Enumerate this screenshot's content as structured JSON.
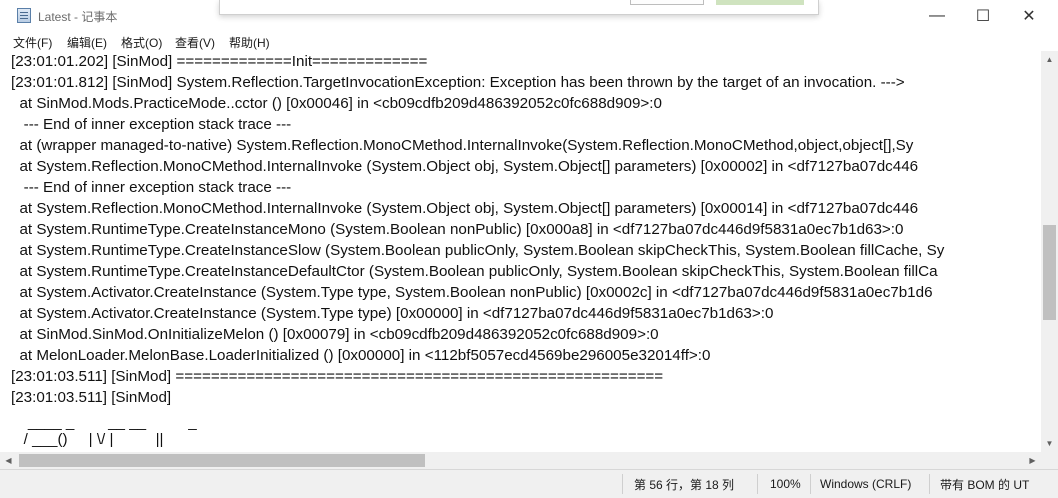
{
  "window": {
    "title": "Latest - 记事本",
    "controls": {
      "minimize": "—",
      "maximize": "☐",
      "close": "✕"
    }
  },
  "menu": [
    "文件(F)",
    "编辑(E)",
    "格式(O)",
    "查看(V)",
    "帮助(H)"
  ],
  "editor": {
    "lines": [
      "[23:01:01.202] [SinMod] =============Init=============",
      "[23:01:01.812] [SinMod] System.Reflection.TargetInvocationException: Exception has been thrown by the target of an invocation. --->",
      "  at SinMod.Mods.PracticeMode..cctor () [0x00046] in <cb09cdfb209d486392052c0fc688d909>:0",
      "   --- End of inner exception stack trace ---",
      "  at (wrapper managed-to-native) System.Reflection.MonoCMethod.InternalInvoke(System.Reflection.MonoCMethod,object,object[],Sy",
      "  at System.Reflection.MonoCMethod.InternalInvoke (System.Object obj, System.Object[] parameters) [0x00002] in <df7127ba07dc446",
      "   --- End of inner exception stack trace ---",
      "  at System.Reflection.MonoCMethod.InternalInvoke (System.Object obj, System.Object[] parameters) [0x00014] in <df7127ba07dc446",
      "  at System.RuntimeType.CreateInstanceMono (System.Boolean nonPublic) [0x000a8] in <df7127ba07dc446d9f5831a0ec7b1d63>:0",
      "  at System.RuntimeType.CreateInstanceSlow (System.Boolean publicOnly, System.Boolean skipCheckThis, System.Boolean fillCache, Sy",
      "  at System.RuntimeType.CreateInstanceDefaultCtor (System.Boolean publicOnly, System.Boolean skipCheckThis, System.Boolean fillCa",
      "  at System.Activator.CreateInstance (System.Type type, System.Boolean nonPublic) [0x0002c] in <df7127ba07dc446d9f5831a0ec7b1d6",
      "  at System.Activator.CreateInstance (System.Type type) [0x00000] in <df7127ba07dc446d9f5831a0ec7b1d63>:0",
      "  at SinMod.SinMod.OnInitializeMelon () [0x00079] in <cb09cdfb209d486392052c0fc688d909>:0",
      "  at MelonLoader.MelonBase.LoaderInitialized () [0x00000] in <112bf5057ecd4569be296005e32014ff>:0",
      "[23:01:03.511] [SinMod] =======================================================",
      "[23:01:03.511] [SinMod]",
      "",
      "    ____ _        __ __          _",
      "   / ___()     | \\/ |          ||"
    ]
  },
  "status": {
    "position": "第 56 行，第 18 列",
    "zoom": "100%",
    "line_ending": "Windows (CRLF)",
    "encoding": "带有 BOM 的 UT"
  }
}
